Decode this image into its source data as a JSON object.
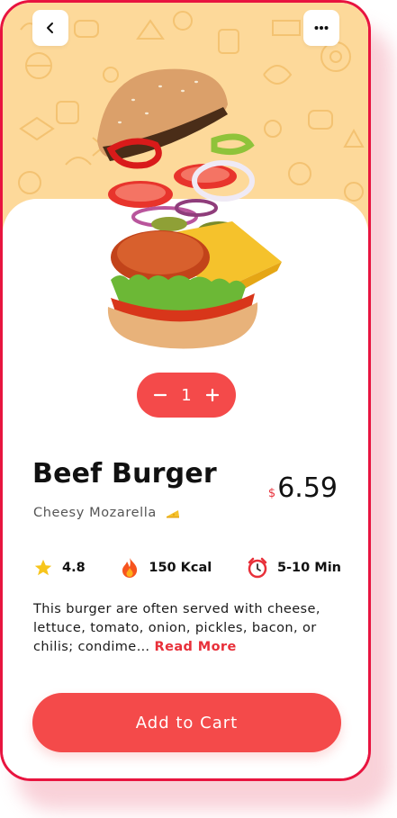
{
  "product": {
    "name": "Beef Burger",
    "subtitle": "Cheesy Mozarella",
    "currency": "$",
    "price": "6.59",
    "quantity": "1"
  },
  "stats": {
    "rating": "4.8",
    "calories": "150 Kcal",
    "time": "5-10 Min"
  },
  "description": {
    "text": "This burger are often served with cheese, lettuce, tomato, onion, pickles, bacon, or chilis; condime…",
    "read_more": "Read More"
  },
  "actions": {
    "add_to_cart": "Add to Cart"
  },
  "colors": {
    "accent": "#f44a4a",
    "frame": "#e8143f",
    "hero_bg": "#fdd99a"
  },
  "icons": [
    "back-arrow-icon",
    "more-dots-icon",
    "minus-icon",
    "plus-icon",
    "cheese-icon",
    "star-icon",
    "fire-icon",
    "alarm-clock-icon"
  ]
}
